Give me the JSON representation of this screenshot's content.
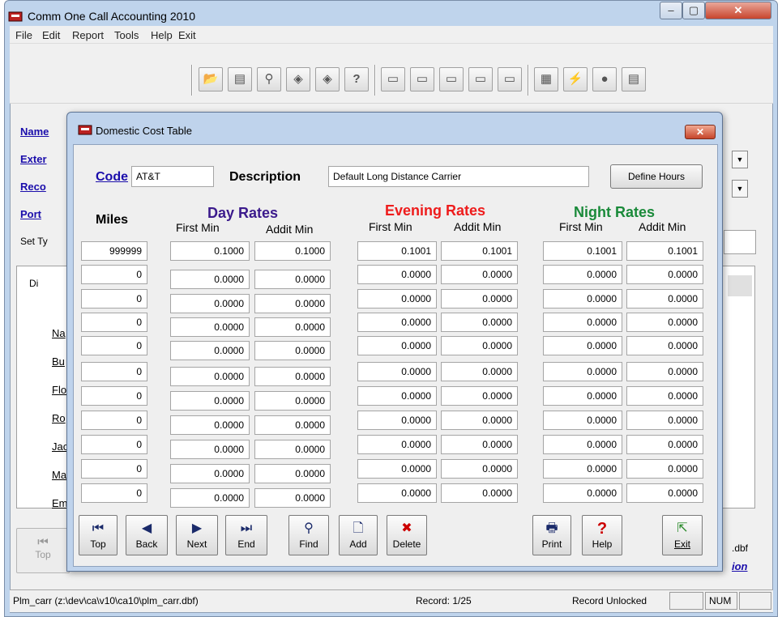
{
  "main_window": {
    "title": "Comm One Call Accounting 2010",
    "minimize": "‒",
    "maximize": "▢",
    "close": "✕",
    "menu": [
      "File",
      "Edit",
      "Report",
      "Tools",
      "Help",
      "Exit"
    ],
    "toolbar_icons": [
      "open-folder-icon",
      "printer-icon",
      "globe-icon",
      "tag-icon",
      "tag2-icon",
      "help-icon",
      "tray1-icon",
      "tray2-icon",
      "tray3-icon",
      "tray4-icon",
      "tray5-icon",
      "network-icon",
      "flash-icon",
      "record-icon",
      "card-icon"
    ],
    "toolbar_glyphs": [
      "📂",
      "▤",
      "⚲",
      "◈",
      "◈",
      "?",
      "▭",
      "▭",
      "▭",
      "▭",
      "▭",
      "▦",
      "⚡",
      "●",
      "▤"
    ],
    "side_links": [
      "Name",
      "Exter",
      "Reco",
      "Port"
    ],
    "set_label": "Set Ty",
    "bg_labels": [
      "Di",
      "Na",
      "Bu",
      "Flo",
      "Ro",
      "Jac",
      "Ma",
      "Em"
    ],
    "top_label": "Top",
    "dbf_label": ".dbf",
    "ion_label": "ion"
  },
  "status_bar": {
    "path": "Plm_carr (z:\\dev\\ca\\v10\\ca10\\plm_carr.dbf)",
    "record": "Record: 1/25",
    "lock": "Record Unlocked",
    "num": "NUM"
  },
  "dialog": {
    "title": "Domestic Cost Table",
    "close": "✕",
    "code_label": "Code",
    "code_value": "AT&T",
    "description_label": "Description",
    "description_value": "Default Long Distance Carrier",
    "define_hours": "Define Hours",
    "miles_label": "Miles",
    "groups": [
      {
        "title": "Day Rates",
        "color": "#3b1a8c",
        "first": "First Min",
        "addit": "Addit Min"
      },
      {
        "title": "Evening Rates",
        "color": "#ee1c1c",
        "first": "First Min",
        "addit": "Addit Min"
      },
      {
        "title": "Night Rates",
        "color": "#1a8a3a",
        "first": "First Min",
        "addit": "Addit Min"
      }
    ],
    "rows": [
      {
        "miles": "999999",
        "day_first": "0.1000",
        "day_addit": "0.1000",
        "eve_first": "0.1001",
        "eve_addit": "0.1001",
        "night_first": "0.1001",
        "night_addit": "0.1001"
      },
      {
        "miles": "0",
        "day_first": "0.0000",
        "day_addit": "0.0000",
        "eve_first": "0.0000",
        "eve_addit": "0.0000",
        "night_first": "0.0000",
        "night_addit": "0.0000"
      },
      {
        "miles": "0",
        "day_first": "0.0000",
        "day_addit": "0.0000",
        "eve_first": "0.0000",
        "eve_addit": "0.0000",
        "night_first": "0.0000",
        "night_addit": "0.0000"
      },
      {
        "miles": "0",
        "day_first": "0.0000",
        "day_addit": "0.0000",
        "eve_first": "0.0000",
        "eve_addit": "0.0000",
        "night_first": "0.0000",
        "night_addit": "0.0000"
      },
      {
        "miles": "0",
        "day_first": "0.0000",
        "day_addit": "0.0000",
        "eve_first": "0.0000",
        "eve_addit": "0.0000",
        "night_first": "0.0000",
        "night_addit": "0.0000"
      },
      {
        "miles": "0",
        "day_first": "0.0000",
        "day_addit": "0.0000",
        "eve_first": "0.0000",
        "eve_addit": "0.0000",
        "night_first": "0.0000",
        "night_addit": "0.0000"
      },
      {
        "miles": "0",
        "day_first": "0.0000",
        "day_addit": "0.0000",
        "eve_first": "0.0000",
        "eve_addit": "0.0000",
        "night_first": "0.0000",
        "night_addit": "0.0000"
      },
      {
        "miles": "0",
        "day_first": "0.0000",
        "day_addit": "0.0000",
        "eve_first": "0.0000",
        "eve_addit": "0.0000",
        "night_first": "0.0000",
        "night_addit": "0.0000"
      },
      {
        "miles": "0",
        "day_first": "0.0000",
        "day_addit": "0.0000",
        "eve_first": "0.0000",
        "eve_addit": "0.0000",
        "night_first": "0.0000",
        "night_addit": "0.0000"
      },
      {
        "miles": "0",
        "day_first": "0.0000",
        "day_addit": "0.0000",
        "eve_first": "0.0000",
        "eve_addit": "0.0000",
        "night_first": "0.0000",
        "night_addit": "0.0000"
      },
      {
        "miles": "0",
        "day_first": "0.0000",
        "day_addit": "0.0000",
        "eve_first": "0.0000",
        "eve_addit": "0.0000",
        "night_first": "0.0000",
        "night_addit": "0.0000"
      }
    ],
    "buttons": [
      {
        "name": "top",
        "icon": "first-record-icon",
        "glyph": "⏮",
        "label": "Top"
      },
      {
        "name": "back",
        "icon": "prev-record-icon",
        "glyph": "◀",
        "label": "Back"
      },
      {
        "name": "next",
        "icon": "next-record-icon",
        "glyph": "▶",
        "label": "Next"
      },
      {
        "name": "end",
        "icon": "last-record-icon",
        "glyph": "⏭",
        "label": "End"
      },
      {
        "name": "find",
        "icon": "binoculars-icon",
        "glyph": "⚲",
        "label": "Find"
      },
      {
        "name": "add",
        "icon": "new-page-icon",
        "glyph": "🗋",
        "label": "Add"
      },
      {
        "name": "delete",
        "icon": "delete-icon",
        "glyph": "✖",
        "label": "Delete"
      },
      {
        "name": "print",
        "icon": "printer-icon",
        "glyph": "🖶",
        "label": "Print"
      },
      {
        "name": "help",
        "icon": "question-icon",
        "glyph": "?",
        "label": "Help"
      },
      {
        "name": "exit",
        "icon": "exit-icon",
        "glyph": "⇱",
        "label": "Exit"
      }
    ]
  }
}
